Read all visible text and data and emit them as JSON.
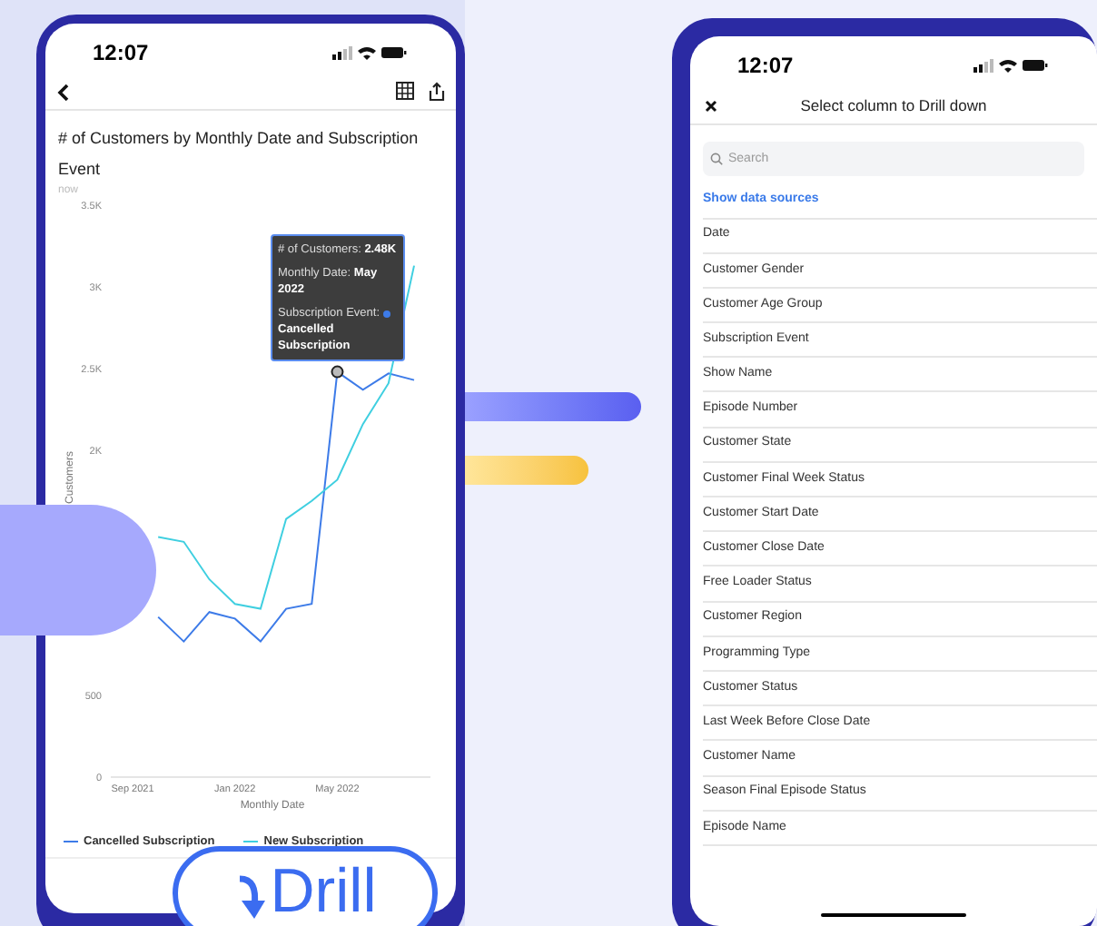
{
  "chart_screen": {
    "status_time": "12:07",
    "title": "# of Customers by Monthly Date and Subscription Event",
    "subtitle": "now",
    "chart_data": {
      "type": "line",
      "xlabel": "Monthly Date",
      "ylabel": "Customers",
      "categories": [
        "Sep 2021",
        null,
        null,
        null,
        "Jan 2022",
        null,
        null,
        null,
        "May 2022",
        null,
        null,
        null
      ],
      "ylim": [
        0,
        3500
      ],
      "yticks": [
        {
          "value": 0,
          "label": "0"
        },
        {
          "value": 500,
          "label": "500"
        },
        {
          "value": 2000,
          "label": "2K"
        },
        {
          "value": 2500,
          "label": "2.5K"
        },
        {
          "value": 3000,
          "label": "3K"
        },
        {
          "value": 3500,
          "label": "3.5K"
        }
      ],
      "series": [
        {
          "name": "Cancelled Subscription",
          "color": "#3d7be8",
          "values": [
            null,
            980,
            830,
            1010,
            970,
            830,
            1030,
            1060,
            2480,
            2370,
            2470,
            2430
          ]
        },
        {
          "name": "New Subscription",
          "color": "#3fcfe0",
          "values": [
            null,
            1470,
            1440,
            1210,
            1060,
            1030,
            1580,
            1690,
            1820,
            2160,
            2410,
            3130
          ]
        }
      ]
    },
    "tooltip": {
      "lines": [
        {
          "text": "# of Customers: **2.48K**"
        },
        {
          "text": "Monthly Date: **May 2022**"
        },
        {
          "text": "Subscription Event:",
          "value": "Cancelled Subscription",
          "color": "#3d7be8"
        }
      ]
    }
  },
  "drill_button": {
    "label": "Drill"
  },
  "drill_screen": {
    "status_time": "12:07",
    "title": "Select column to Drill down",
    "search": {
      "placeholder": "Search"
    },
    "link": "Show data sources",
    "columns": [
      "Date",
      "Customer Gender",
      "Customer Age Group",
      "Subscription Event",
      "Show Name",
      "Episode Number",
      "Customer State",
      "Customer Final Week Status",
      "Customer Start Date",
      "Customer Close Date",
      "Free Loader Status",
      "Customer Region",
      "Programming Type",
      "Customer Status",
      "Last Week Before Close Date",
      "Customer Name",
      "Season Final Episode Status",
      "Episode Name"
    ]
  }
}
